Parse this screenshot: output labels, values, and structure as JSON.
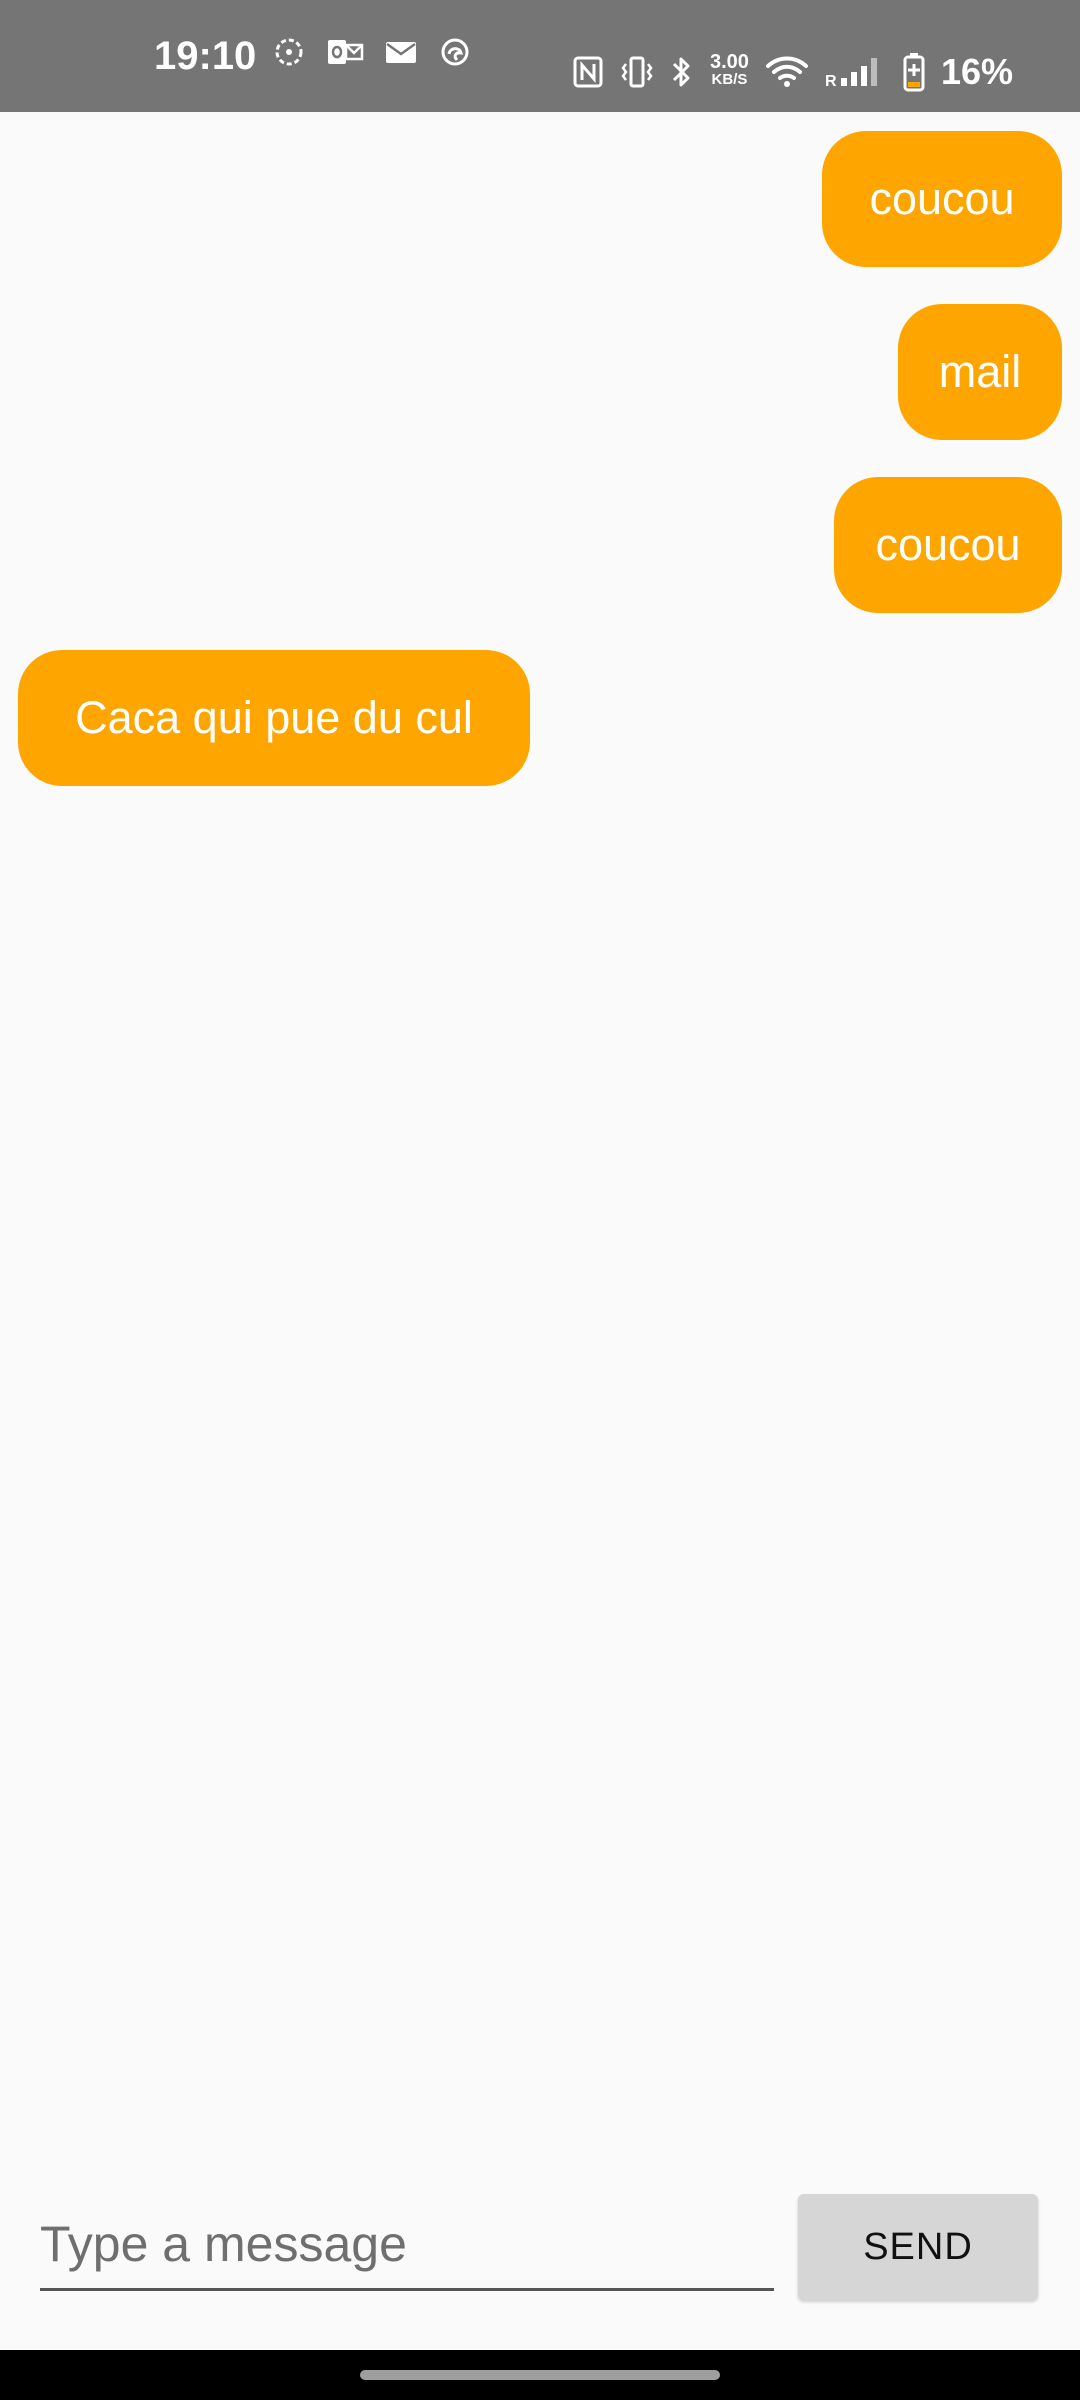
{
  "status_bar": {
    "time": "19:10",
    "net_speed_value": "3.00",
    "net_speed_unit": "KB/S",
    "signal_roaming": "R",
    "battery_percent": "16%",
    "background_color": "#757575"
  },
  "messages": [
    {
      "text": "coucou",
      "side": "right"
    },
    {
      "text": "mail",
      "side": "right"
    },
    {
      "text": "coucou",
      "side": "right"
    },
    {
      "text": "Caca qui pue du cul",
      "side": "left"
    }
  ],
  "bubble_color": "#ffa500",
  "composer": {
    "placeholder": "Type a message",
    "value": "",
    "send_label": "SEND"
  },
  "icons": {
    "left": [
      "sync-icon",
      "outlook-icon",
      "email-icon",
      "edge-icon"
    ],
    "right": [
      "nfc-icon",
      "vibrate-icon",
      "bluetooth-icon",
      "wifi-icon",
      "signal-icon",
      "battery-icon"
    ]
  }
}
